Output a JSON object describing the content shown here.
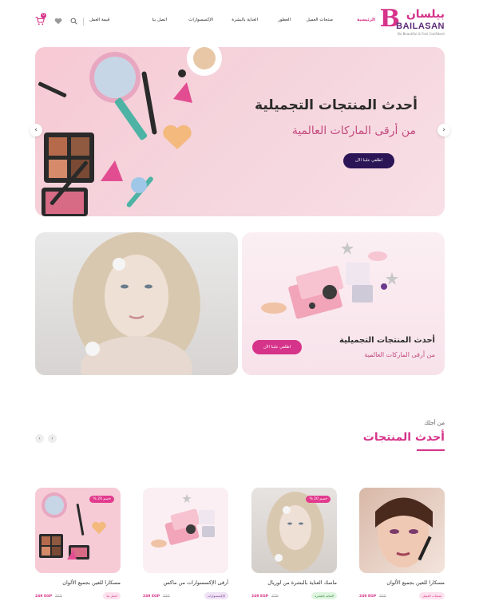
{
  "header": {
    "logo": {
      "mark": "B",
      "arabic": "بيلسان",
      "english": "BAILASAN",
      "tagline": "Be Beautiful & Feel Confident"
    },
    "nav": [
      {
        "label": "الرئيسية",
        "active": true
      },
      {
        "label": "منتجات العميل",
        "active": false
      },
      {
        "label": "العطور",
        "active": false
      },
      {
        "label": "العناية بالبشرة",
        "active": false
      },
      {
        "label": "الإكسسوارات",
        "active": false
      },
      {
        "label": "اتصل بنا",
        "active": false
      }
    ],
    "account": "قيمة العمل",
    "cart_count": "0"
  },
  "hero": {
    "title": "أحدث المنتجات التجميلية",
    "subtitle": "من أرقى الماركات العالمية",
    "button": "اطلقي علينا الآن",
    "prev_arrow": "‹",
    "next_arrow": "›"
  },
  "promo": {
    "title": "أحدث المنتجات التجميلية",
    "subtitle": "من أرقى الماركات العالمية",
    "button": "اطلقي علينا الآن"
  },
  "section": {
    "kicker": "من أجلك",
    "title": "أحدث المنتجات",
    "prev": "‹",
    "next": "›"
  },
  "products": [
    {
      "name": "مسكارا للعين بجميع الألوان",
      "category": "منتجات العميل",
      "price": "249 EGP",
      "old_price": "320",
      "badge": "",
      "category_color": "#fde2ee"
    },
    {
      "name": "ماسك العناية بالبشرة من لوريال",
      "category": "العناية بالبشرة",
      "price": "249 EGP",
      "old_price": "320",
      "badge": "خصم 20 %",
      "category_color": "#dff5e0"
    },
    {
      "name": "أرقى الإكسسوارات من ماكس",
      "category": "الإكسسوارات",
      "price": "249 EGP",
      "old_price": "320",
      "badge": "",
      "category_color": "#efe3f5"
    },
    {
      "name": "مسكارا للعين بجميع الألوان",
      "category": "اتصل بنا",
      "price": "249 EGP",
      "old_price": "320",
      "badge": "خصم 20 %",
      "category_color": "#fde2ee"
    }
  ]
}
